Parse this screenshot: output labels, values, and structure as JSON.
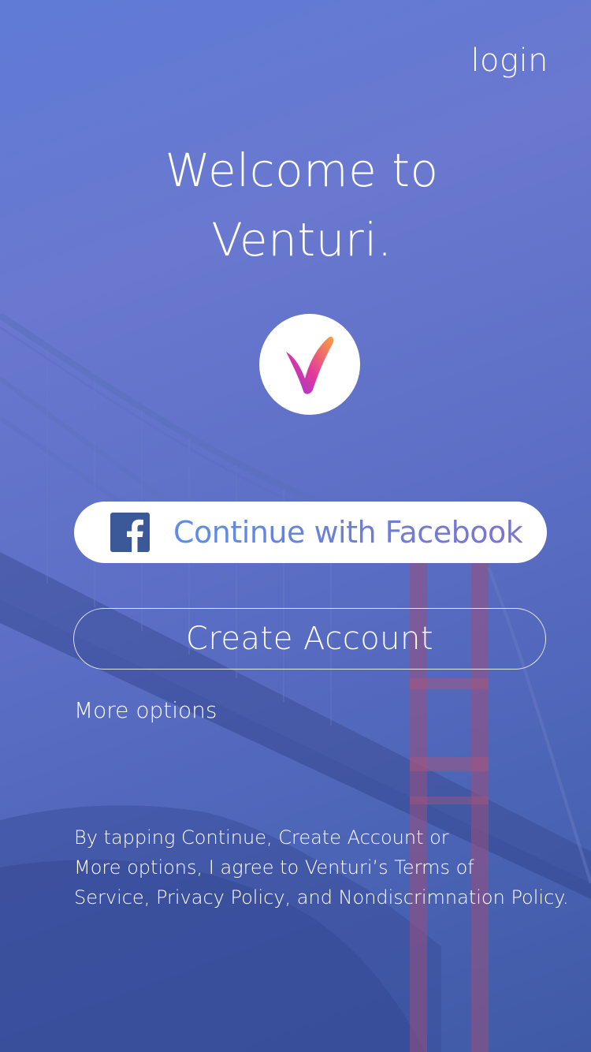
{
  "header": {
    "login_label": "login"
  },
  "welcome": {
    "line1": "Welcome to",
    "line2": "Venturi."
  },
  "logo": {
    "icon": "venturi-checkmark-logo",
    "gradient": [
      "#f7a23c",
      "#e2389e",
      "#8e3ad6"
    ]
  },
  "facebook_button": {
    "label": "Continue with Facebook",
    "icon": "facebook-logo-icon",
    "icon_color": "#3b5998"
  },
  "create_account_button": {
    "label": "Create Account"
  },
  "more_options": {
    "label": "More options"
  },
  "legal": {
    "lines": [
      "By tapping Continue, Create Account or",
      "More options, I agree to Venturi’s Terms of",
      "Service, Privacy Policy, and Nondiscrimnation Policy."
    ]
  },
  "colors": {
    "background_top": "#5f7bd6",
    "background_bottom": "#3f5aa6",
    "bridge_accent": "#b4506e"
  }
}
